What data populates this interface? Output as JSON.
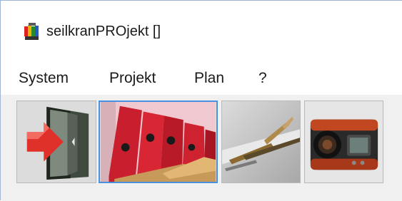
{
  "window": {
    "title": "seilkranPROjekt []",
    "icon": "app-logo-icon"
  },
  "menubar": {
    "items": [
      {
        "label": "System"
      },
      {
        "label": "Projekt"
      },
      {
        "label": "Plan"
      },
      {
        "label": "?"
      }
    ]
  },
  "toolbar": {
    "buttons": [
      {
        "icon": "exit-door-icon",
        "active": false
      },
      {
        "icon": "project-folders-icon",
        "active": true
      },
      {
        "icon": "plan-drawing-tools-icon",
        "active": false
      },
      {
        "icon": "rangefinder-device-icon",
        "active": false
      }
    ]
  }
}
